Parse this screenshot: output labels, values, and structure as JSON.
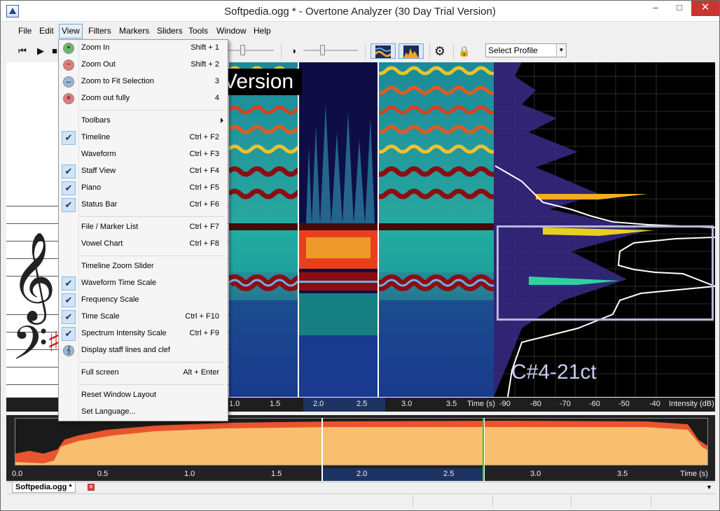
{
  "window": {
    "title": "Softpedia.ogg * - Overtone Analyzer (30 Day Trial Version)",
    "min": "–",
    "max": "□",
    "close": "✕"
  },
  "menubar": [
    "File",
    "Edit",
    "View",
    "Filters",
    "Markers",
    "Sliders",
    "Tools",
    "Window",
    "Help"
  ],
  "toolbar": {
    "profile_value": "Select Profile",
    "prev": "⏮",
    "play": "▶",
    "stop": "■",
    "contrast": "◑",
    "gear": "⚙",
    "lock": "🔒"
  },
  "view_menu": [
    {
      "label": "Zoom In",
      "shortcut": "Shift + 1",
      "icon": "zoom-in-icon",
      "glyph": "+",
      "color": "#6bb86b"
    },
    {
      "label": "Zoom Out",
      "shortcut": "Shift + 2",
      "icon": "zoom-out-icon",
      "glyph": "−",
      "color": "#e27a7a"
    },
    {
      "label": "Zoom to Fit Selection",
      "shortcut": "3",
      "icon": "zoom-fit-icon",
      "glyph": "↔",
      "color": "#9ab8d8"
    },
    {
      "label": "Zoom out fully",
      "shortcut": "4",
      "icon": "zoom-out-fully-icon",
      "glyph": "×",
      "color": "#e27a7a"
    },
    {
      "sep": true
    },
    {
      "label": "Toolbars",
      "shortcut": "",
      "submenu": true
    },
    {
      "label": "Timeline",
      "shortcut": "Ctrl + F2",
      "checked": true
    },
    {
      "label": "Waveform",
      "shortcut": "Ctrl + F3"
    },
    {
      "label": "Staff View",
      "shortcut": "Ctrl + F4",
      "checked": true
    },
    {
      "label": "Piano",
      "shortcut": "Ctrl + F5",
      "checked": true
    },
    {
      "label": "Status Bar",
      "shortcut": "Ctrl + F6",
      "checked": true
    },
    {
      "sep": true
    },
    {
      "label": "File / Marker List",
      "shortcut": "Ctrl + F7"
    },
    {
      "label": "Vowel Chart",
      "shortcut": "Ctrl + F8"
    },
    {
      "sep": true
    },
    {
      "label": "Timeline Zoom Slider",
      "shortcut": ""
    },
    {
      "label": "Waveform Time Scale",
      "shortcut": "",
      "checked": true
    },
    {
      "label": "Frequency Scale",
      "shortcut": "",
      "checked": true
    },
    {
      "label": "Time Scale",
      "shortcut": "Ctrl + F10",
      "checked": true
    },
    {
      "label": "Spectrum Intensity Scale",
      "shortcut": "Ctrl + F9",
      "checked": true
    },
    {
      "label": "Display staff lines and clef",
      "shortcut": "",
      "icon": "clef-icon",
      "glyph": "𝄞",
      "color": "#9ab8d8"
    },
    {
      "sep": true
    },
    {
      "label": "Full screen",
      "shortcut": "Alt + Enter"
    },
    {
      "sep": true
    },
    {
      "label": "Reset Window Layout",
      "shortcut": ""
    },
    {
      "label": "Set Language...",
      "shortcut": ""
    }
  ],
  "watermark": "Version",
  "note_label": "C#4-21ct",
  "time_axis": [
    "1.0",
    "1.5",
    "2.0",
    "2.5",
    "3.0",
    "3.5",
    "Time (s)"
  ],
  "intensity_axis": [
    "-90",
    "-80",
    "-70",
    "-60",
    "-50",
    "-40",
    "Intensity (dB)"
  ],
  "overview_axis": [
    "0.0",
    "0.5",
    "1.0",
    "1.5",
    "2.0",
    "2.5",
    "3.0",
    "3.5",
    "Time (s)"
  ],
  "tab": {
    "label": "Softpedia.ogg *",
    "close": "✕"
  },
  "colors": {
    "waveform_fill": "#f7bf6e",
    "waveform_edge": "#e8552e",
    "selection": "#1d3364",
    "playhead": "#33cc33",
    "menu_check_bg": "#cfe4f7"
  }
}
